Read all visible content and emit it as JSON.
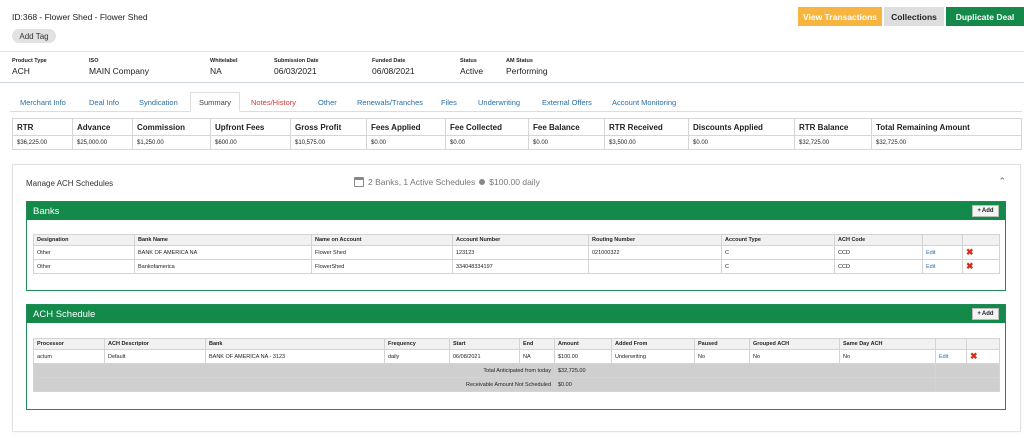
{
  "header": {
    "title": "ID:368 - Flower Shed - Flower Shed",
    "add_tag": "Add Tag",
    "view_transactions": "View Transactions",
    "collections": "Collections",
    "duplicate_deal": "Duplicate Deal"
  },
  "info": [
    {
      "label": "Product Type",
      "value": "ACH"
    },
    {
      "label": "ISO",
      "value": "MAIN Company"
    },
    {
      "label": "Whitelabel",
      "value": "NA"
    },
    {
      "label": "Submission Date",
      "value": "06/03/2021"
    },
    {
      "label": "Funded Date",
      "value": "06/08/2021"
    },
    {
      "label": "Status",
      "value": "Active"
    },
    {
      "label": "AM Status",
      "value": "Performing"
    }
  ],
  "tabs": [
    "Merchant Info",
    "Deal Info",
    "Syndication",
    "Summary",
    "Notes/History",
    "Other",
    "Renewals/Tranches",
    "Files",
    "Underwriting",
    "External Offers",
    "Account Monitoring"
  ],
  "summary": {
    "headers": [
      "RTR",
      "Advance",
      "Commission",
      "Upfront Fees",
      "Gross Profit",
      "Fees Applied",
      "Fee Collected",
      "Fee Balance",
      "RTR Received",
      "Discounts Applied",
      "RTR Balance",
      "Total Remaining Amount"
    ],
    "values": [
      "$36,225.00",
      "$25,000.00",
      "$1,250.00",
      "$600.00",
      "$10,575.00",
      "$0.00",
      "$0.00",
      "$0.00",
      "$3,500.00",
      "$0.00",
      "$32,725.00",
      "$32,725.00"
    ]
  },
  "ach": {
    "title": "Manage ACH Schedules",
    "meta": "2 Banks, 1 Active Schedules",
    "daily": "$100.00 daily",
    "add_label": "Add",
    "edit_label": "Edit",
    "banks": {
      "title": "Banks",
      "headers": [
        "Designation",
        "Bank Name",
        "Name on Account",
        "Account Number",
        "Routing Number",
        "Account Type",
        "ACH Code"
      ],
      "rows": [
        [
          "Other",
          "BANK OF AMERICA NA",
          "Flower Shed",
          "123123",
          "021000322",
          "C",
          "CCD"
        ],
        [
          "Other",
          "Bankofamerica",
          "FlowerShed",
          "334048334197",
          "",
          "C",
          "CCD"
        ]
      ]
    },
    "schedule": {
      "title": "ACH Schedule",
      "headers": [
        "Processor",
        "ACH Descriptor",
        "Bank",
        "Frequency",
        "Start",
        "End",
        "Amount",
        "Added From",
        "Paused",
        "Grouped ACH",
        "Same Day ACH"
      ],
      "rows": [
        [
          "actum",
          "Default",
          "BANK OF AMERICA NA - 3123",
          "daily",
          "06/08/2021",
          "NA",
          "$100.00",
          "Underwriting",
          "No",
          "No",
          "No"
        ]
      ],
      "total_label": "Total Anticipated from today",
      "total_value": "$32,725.00",
      "unscheduled_label": "Receivable Amount Not Scheduled",
      "unscheduled_value": "$0.00"
    }
  }
}
